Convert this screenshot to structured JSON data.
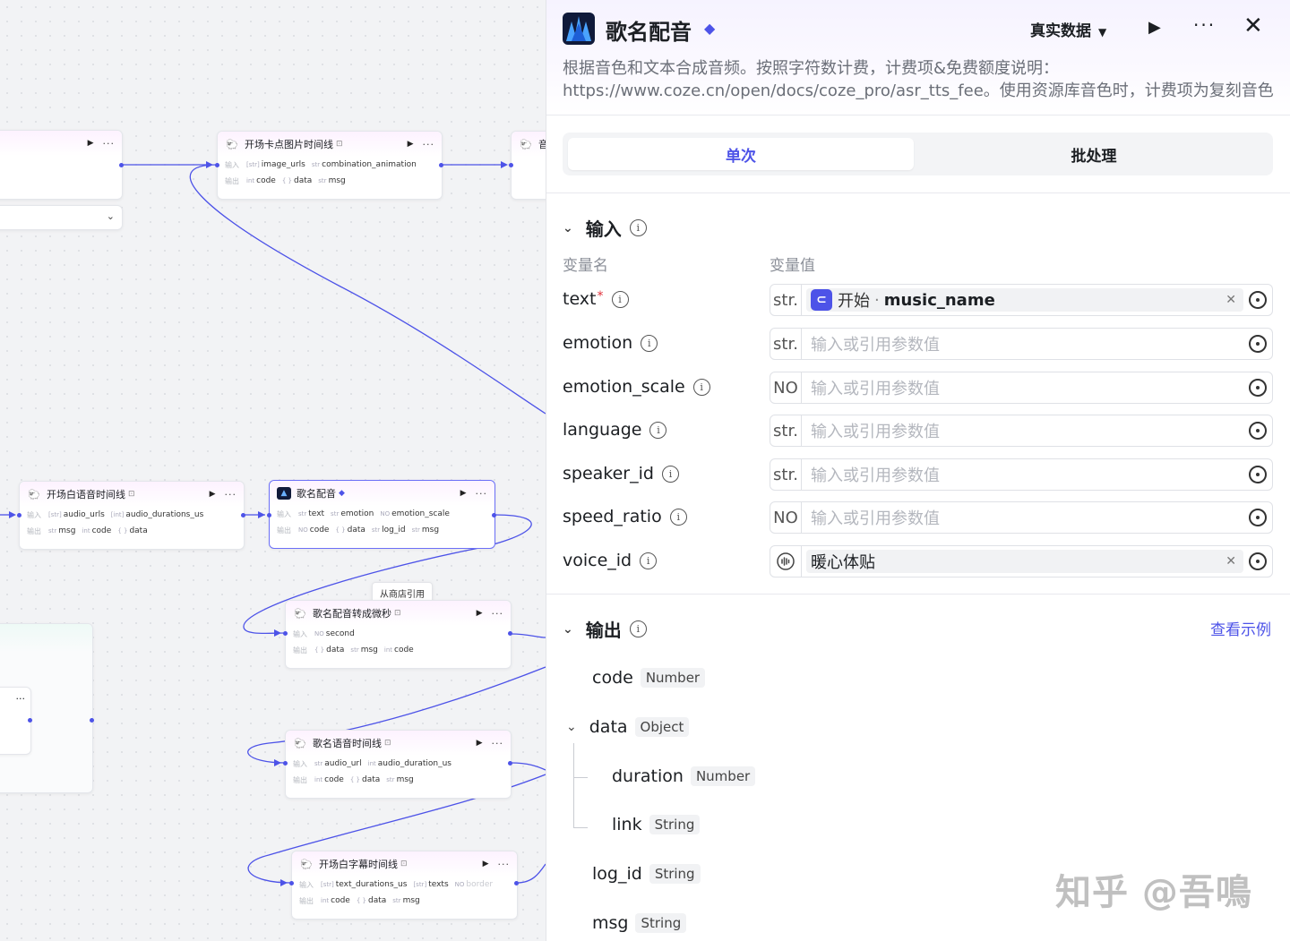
{
  "canvas": {
    "nodes": [
      {
        "id": "n0",
        "title": "",
        "in": [],
        "out": []
      },
      {
        "id": "n1",
        "title": "开场卡点图片时间线",
        "tag": "⊡",
        "in": [
          {
            "t": "[str]",
            "n": "image_urls"
          },
          {
            "t": "str",
            "n": "combination_animation"
          }
        ],
        "out": [
          {
            "t": "int",
            "n": "code"
          },
          {
            "t": "{ }",
            "n": "data"
          },
          {
            "t": "str",
            "n": "msg"
          }
        ]
      },
      {
        "id": "n2",
        "title": "开场白语音时间线",
        "tag": "⊡",
        "in": [
          {
            "t": "[str]",
            "n": "audio_urls"
          },
          {
            "t": "[int]",
            "n": "audio_durations_us"
          }
        ],
        "out": [
          {
            "t": "str",
            "n": "msg"
          },
          {
            "t": "int",
            "n": "code"
          },
          {
            "t": "{ }",
            "n": "data"
          }
        ]
      },
      {
        "id": "n3",
        "title": "歌名配音",
        "tag": "◆",
        "in": [
          {
            "t": "str",
            "n": "text"
          },
          {
            "t": "str",
            "n": "emotion"
          },
          {
            "t": "NO",
            "n": "emotion_scale"
          }
        ],
        "out": [
          {
            "t": "NO",
            "n": "code"
          },
          {
            "t": "{ }",
            "n": "data"
          },
          {
            "t": "str",
            "n": "log_id"
          },
          {
            "t": "str",
            "n": "msg"
          }
        ]
      },
      {
        "id": "n4",
        "title": "歌名配音转成微秒",
        "tag": "⊡",
        "in": [
          {
            "t": "NO",
            "n": "second"
          }
        ],
        "out": [
          {
            "t": "{ }",
            "n": "data"
          },
          {
            "t": "str",
            "n": "msg"
          },
          {
            "t": "int",
            "n": "code"
          }
        ]
      },
      {
        "id": "n5",
        "title": "歌名语音时间线",
        "tag": "⊡",
        "in": [
          {
            "t": "str",
            "n": "audio_url"
          },
          {
            "t": "int",
            "n": "audio_duration_us"
          }
        ],
        "out": [
          {
            "t": "int",
            "n": "code"
          },
          {
            "t": "{ }",
            "n": "data"
          },
          {
            "t": "str",
            "n": "msg"
          }
        ]
      },
      {
        "id": "n6",
        "title": "开场白字幕时间线",
        "tag": "⊡",
        "in": [
          {
            "t": "[str]",
            "n": "text_durations_us"
          },
          {
            "t": "[str]",
            "n": "texts"
          },
          {
            "t": "NO",
            "n": "border"
          }
        ],
        "out": [
          {
            "t": "int",
            "n": "code"
          },
          {
            "t": "{ }",
            "n": "data"
          },
          {
            "t": "str",
            "n": "msg"
          }
        ]
      }
    ],
    "in_label": "输入",
    "out_label": "输出",
    "tooltip": "从商店引用",
    "partial_title": "音"
  },
  "panel": {
    "title": "歌名配音",
    "data_source": "真实数据",
    "description": "根据音色和文本合成音频。按照字符数计费，计费项&免费额度说明：https://www.coze.cn/open/docs/coze_pro/asr_tts_fee。使用资源库音色时，计费项为复刻音色文字转语音字数；使用预设…",
    "tabs": [
      "单次",
      "批处理"
    ],
    "input_section": "输入",
    "col_name": "变量名",
    "col_value": "变量值",
    "placeholder": "输入或引用参数值",
    "fields": [
      {
        "name": "text",
        "required": "*",
        "type": "str.",
        "ref_source": "开始",
        "ref_var": "music_name"
      },
      {
        "name": "emotion",
        "required": "",
        "type": "str."
      },
      {
        "name": "emotion_scale",
        "required": "",
        "type": "NO"
      },
      {
        "name": "language",
        "required": "",
        "type": "str."
      },
      {
        "name": "speaker_id",
        "required": "",
        "type": "str."
      },
      {
        "name": "speed_ratio",
        "required": "",
        "type": "NO"
      },
      {
        "name": "voice_id",
        "required": "",
        "type": "voice",
        "value": "暖心体贴"
      }
    ],
    "output_section": "输出",
    "example_link": "查看示例",
    "outputs": [
      {
        "name": "code",
        "type": "Number"
      },
      {
        "name": "data",
        "type": "Object"
      },
      {
        "name": "duration",
        "type": "Number"
      },
      {
        "name": "link",
        "type": "String"
      },
      {
        "name": "log_id",
        "type": "String"
      },
      {
        "name": "msg",
        "type": "String"
      }
    ]
  },
  "watermark": "知乎 @吾鳴",
  "colors": {
    "accent": "#4d53e8",
    "wire": "#4d53e8",
    "panel_header": "#f6f3ff"
  }
}
